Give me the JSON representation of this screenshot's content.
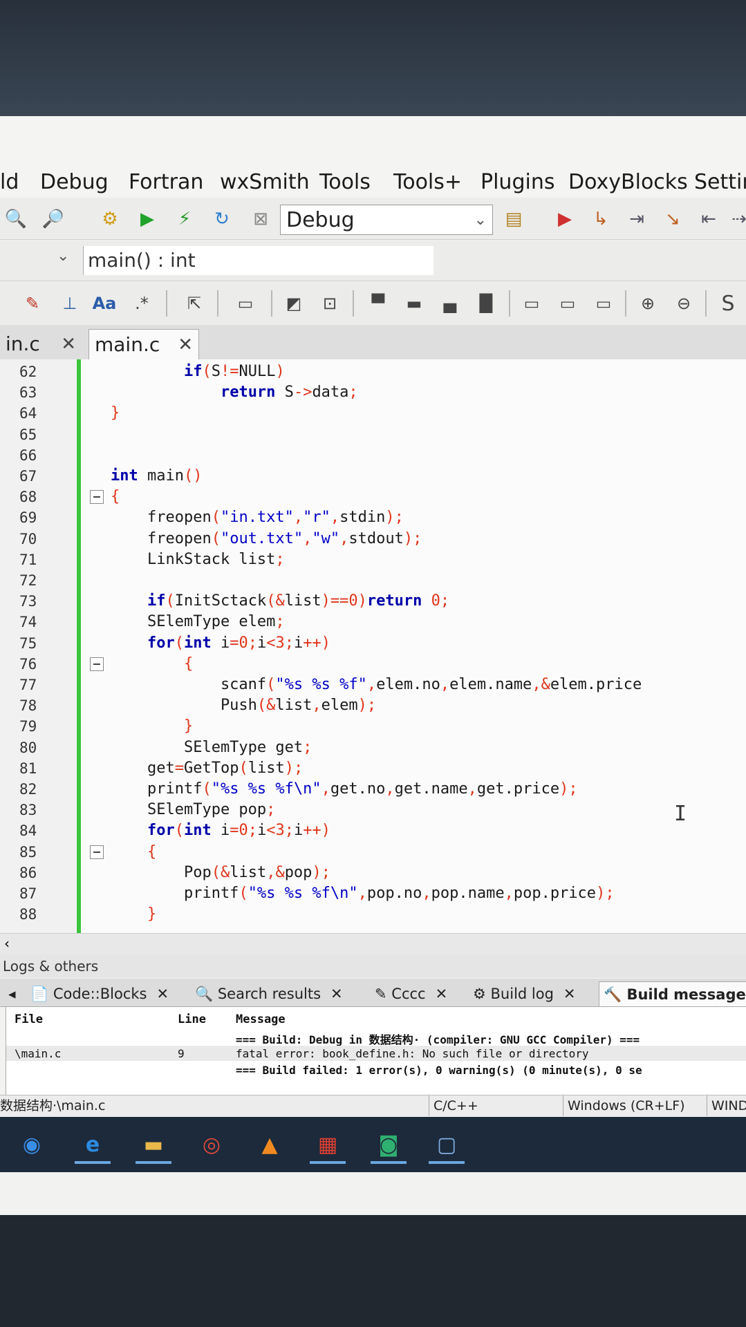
{
  "menu": [
    "ld",
    "Debug",
    "Fortran",
    "wxSmith",
    "Tools",
    "Tools+",
    "Plugins",
    "DoxyBlocks",
    "Settin"
  ],
  "toolbar": {
    "build_target": "Debug"
  },
  "scope": {
    "function": "main() : int"
  },
  "tabs": [
    {
      "label": "in.c",
      "close": "✕"
    },
    {
      "label": "main.c",
      "close": "✕"
    }
  ],
  "editor": {
    "lines": [
      {
        "n": "62",
        "code": "        if(S!=NULL)"
      },
      {
        "n": "63",
        "code": "            return S->data;"
      },
      {
        "n": "64",
        "code": "}"
      },
      {
        "n": "65",
        "code": ""
      },
      {
        "n": "66",
        "code": ""
      },
      {
        "n": "67",
        "code": "int main()"
      },
      {
        "n": "68",
        "code": "{"
      },
      {
        "n": "69",
        "code": "    freopen(\"in.txt\",\"r\",stdin);"
      },
      {
        "n": "70",
        "code": "    freopen(\"out.txt\",\"w\",stdout);"
      },
      {
        "n": "71",
        "code": "    LinkStack list;"
      },
      {
        "n": "72",
        "code": ""
      },
      {
        "n": "73",
        "code": "    if(InitSctack(&list)==0)return 0;"
      },
      {
        "n": "74",
        "code": "    SElemType elem;"
      },
      {
        "n": "75",
        "code": "    for(int i=0;i<3;i++)"
      },
      {
        "n": "76",
        "code": "        {"
      },
      {
        "n": "77",
        "code": "            scanf(\"%s %s %f\",elem.no,elem.name,&elem.price"
      },
      {
        "n": "78",
        "code": "            Push(&list,elem);"
      },
      {
        "n": "79",
        "code": "        }"
      },
      {
        "n": "80",
        "code": "        SElemType get;"
      },
      {
        "n": "81",
        "code": "    get=GetTop(list);"
      },
      {
        "n": "82",
        "code": "    printf(\"%s %s %f\\n\",get.no,get.name,get.price);"
      },
      {
        "n": "83",
        "code": "    SElemType pop;"
      },
      {
        "n": "84",
        "code": "    for(int i=0;i<3;i++)"
      },
      {
        "n": "85",
        "code": "    {"
      },
      {
        "n": "86",
        "code": "        Pop(&list,&pop);"
      },
      {
        "n": "87",
        "code": "        printf(\"%s %s %f\\n\",pop.no,pop.name,pop.price);"
      },
      {
        "n": "88",
        "code": "    }"
      }
    ]
  },
  "logs": {
    "title": "Logs & others",
    "tabs": [
      "Code::Blocks",
      "Search results",
      "Cccc",
      "Build log",
      "Build messages"
    ],
    "columns": [
      "File",
      "Line",
      "Message"
    ],
    "rows": [
      {
        "file": "",
        "line": "",
        "message": "=== Build: Debug in 数据结构· (compiler: GNU GCC Compiler) ==="
      },
      {
        "file": "\\main.c",
        "line": "9",
        "message": "fatal error: book_define.h: No such file or directory"
      },
      {
        "file": "",
        "line": "",
        "message": "=== Build failed: 1 error(s), 0 warning(s) (0 minute(s), 0 se"
      }
    ]
  },
  "status": {
    "path": "数据结构·\\main.c",
    "language": "C/C++",
    "eol": "Windows (CR+LF)",
    "encoding": "WIND"
  }
}
